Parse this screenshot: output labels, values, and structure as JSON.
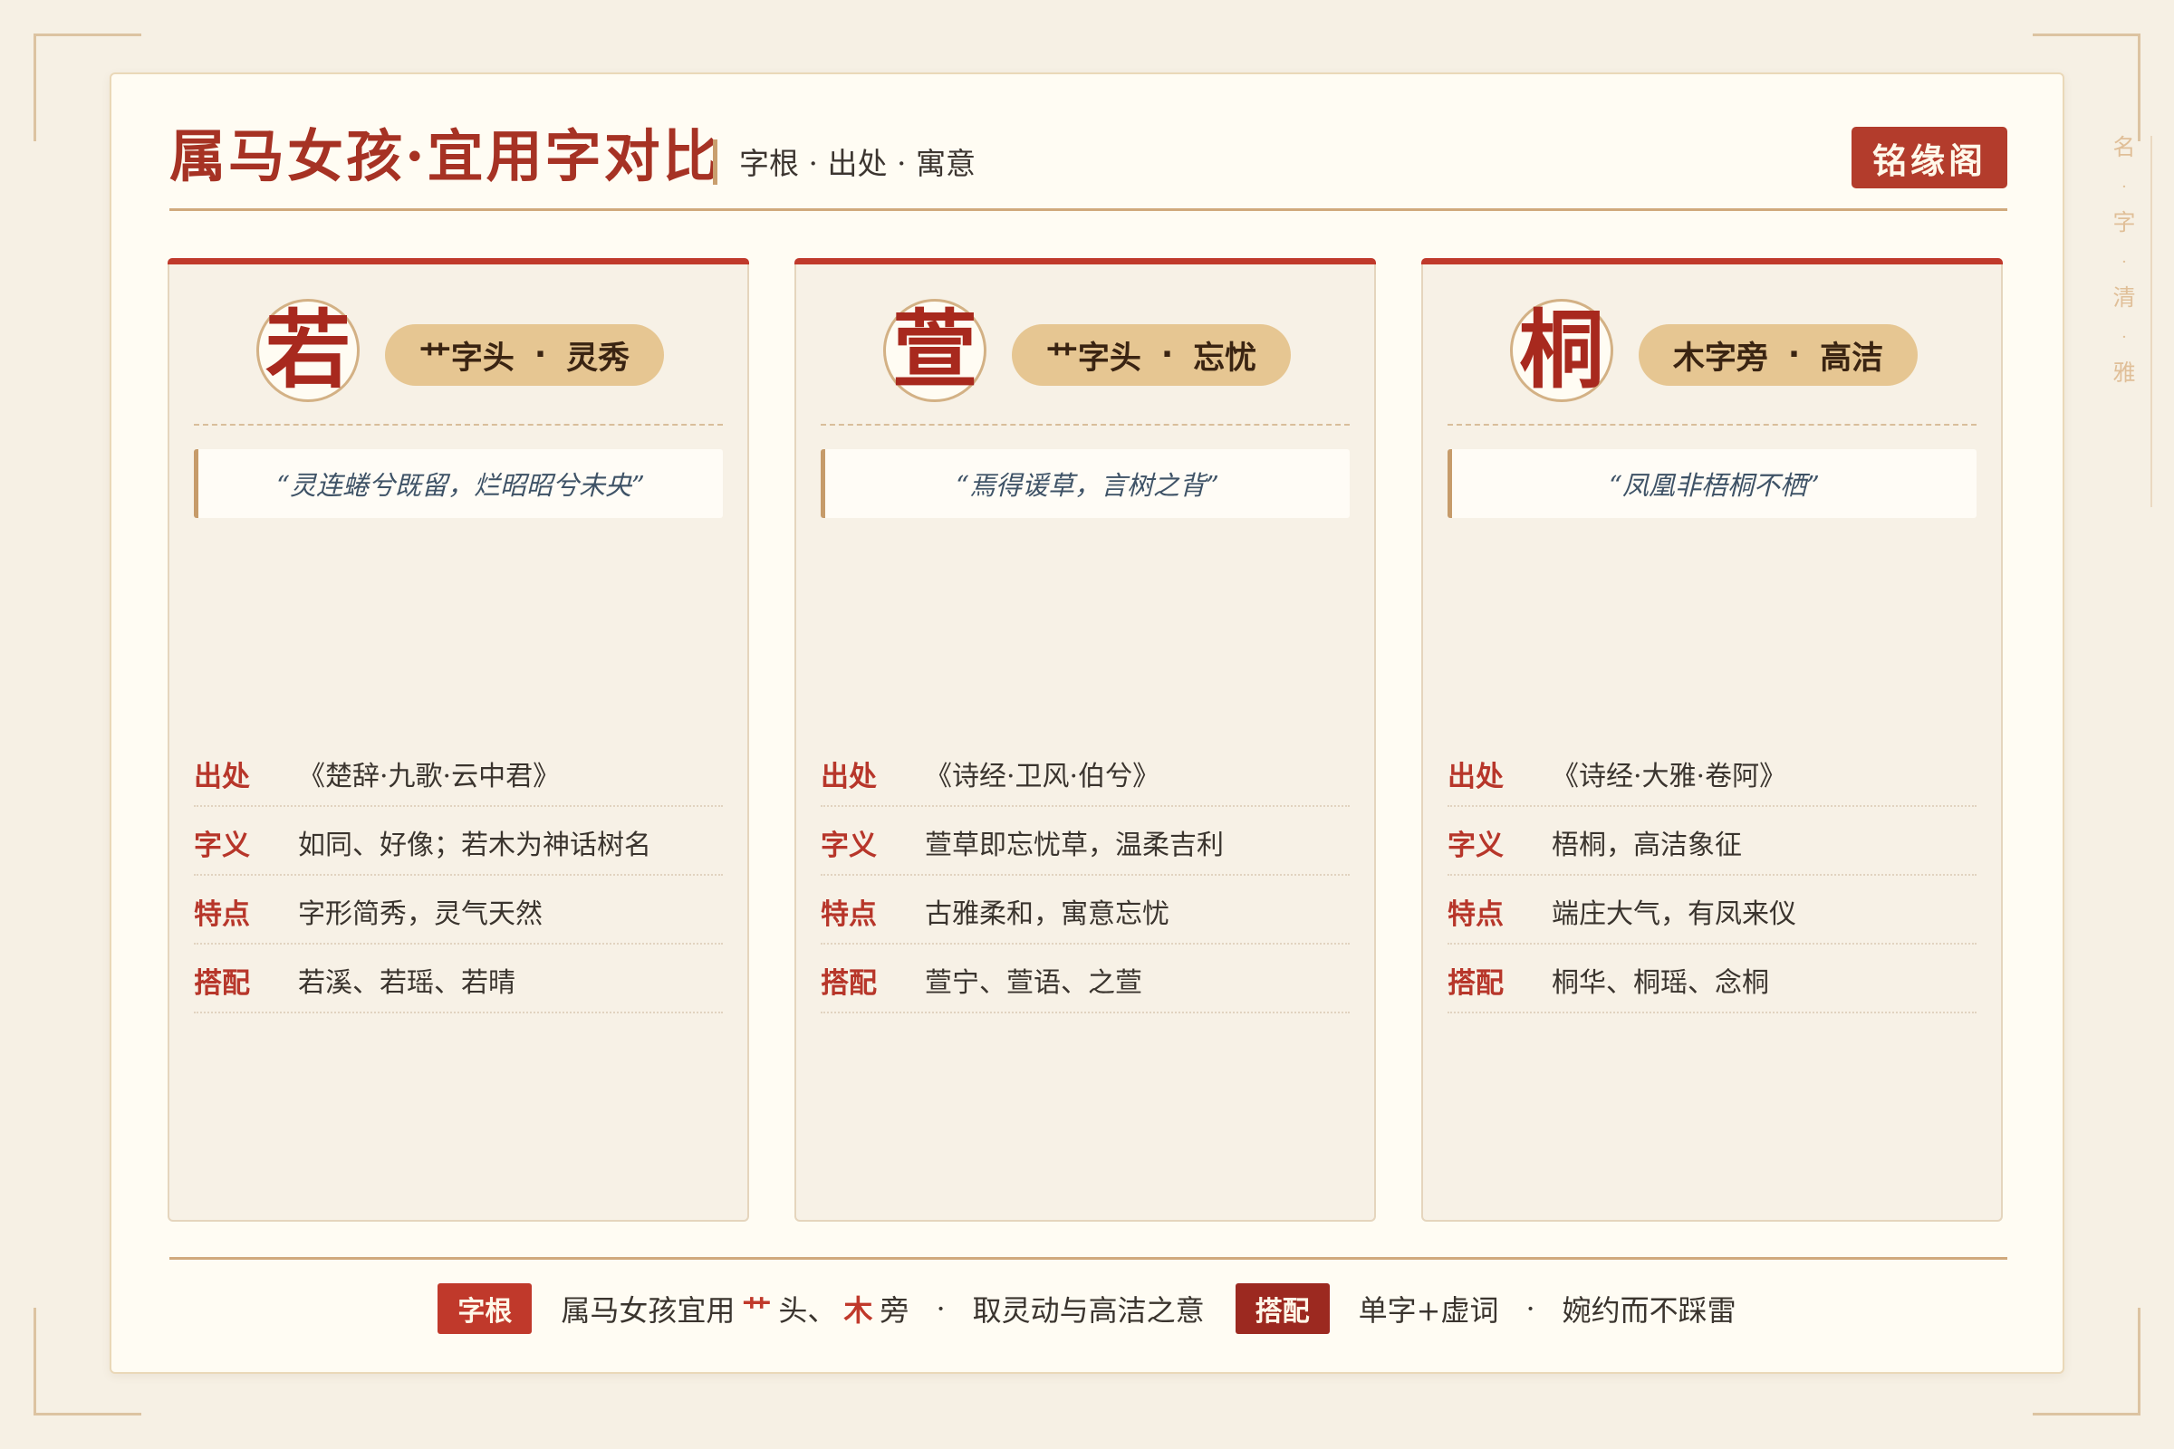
{
  "side_label": [
    "名",
    "字",
    "清",
    "雅"
  ],
  "header": {
    "title": "属马女孩·宜用字对比",
    "subtitle": "字根 · 出处 · 寓意",
    "brand": "铭缘阁"
  },
  "cards": [
    {
      "char": "若",
      "radical": "艹字头",
      "keyword": "灵秀",
      "quote": "“灵连蜷兮既留，烂昭昭兮未央”",
      "rows": [
        {
          "label": "出处",
          "value": "《楚辞·九歌·云中君》"
        },
        {
          "label": "字义",
          "value": "如同、好像；若木为神话树名"
        },
        {
          "label": "特点",
          "value": "字形简秀，灵气天然"
        },
        {
          "label": "搭配",
          "value": "若溪、若瑶、若晴"
        }
      ]
    },
    {
      "char": "萱",
      "radical": "艹字头",
      "keyword": "忘忧",
      "quote": "“焉得谖草，言树之背”",
      "rows": [
        {
          "label": "出处",
          "value": "《诗经·卫风·伯兮》"
        },
        {
          "label": "字义",
          "value": "萱草即忘忧草，温柔吉利"
        },
        {
          "label": "特点",
          "value": "古雅柔和，寓意忘忧"
        },
        {
          "label": "搭配",
          "value": "萱宁、萱语、之萱"
        }
      ]
    },
    {
      "char": "桐",
      "radical": "木字旁",
      "keyword": "高洁",
      "quote": "“凤凰非梧桐不栖”",
      "rows": [
        {
          "label": "出处",
          "value": "《诗经·大雅·卷阿》"
        },
        {
          "label": "字义",
          "value": "梧桐，高洁象征"
        },
        {
          "label": "特点",
          "value": "端庄大气，有凤来仪"
        },
        {
          "label": "搭配",
          "value": "桐华、桐瑶、念桐"
        }
      ]
    }
  ],
  "footer": {
    "badge1": "字根",
    "text1_a": "属马女孩宜用",
    "hl1": "艹",
    "text1_b": "头、",
    "hl2": "木",
    "text1_c": "旁",
    "sep": "·",
    "text1_d": "取灵动与高洁之意",
    "badge2": "搭配",
    "text2_a": "单字+虚词",
    "text2_b": "婉约而不踩雷"
  }
}
